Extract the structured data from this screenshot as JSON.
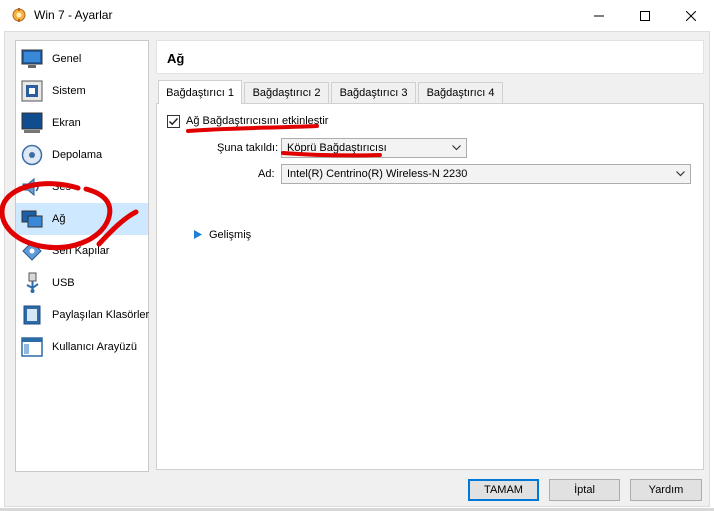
{
  "window": {
    "title": "Win 7 - Ayarlar",
    "minimize_icon": "minimize-icon",
    "maximize_icon": "maximize-icon",
    "close_icon": "close-icon"
  },
  "sidebar": {
    "items": [
      {
        "label": "Genel",
        "icon": "monitor-icon",
        "selected": false
      },
      {
        "label": "Sistem",
        "icon": "chip-icon",
        "selected": false
      },
      {
        "label": "Ekran",
        "icon": "display-icon",
        "selected": false
      },
      {
        "label": "Depolama",
        "icon": "disk-icon",
        "selected": false
      },
      {
        "label": "Ses",
        "icon": "speaker-icon",
        "selected": false
      },
      {
        "label": "Ağ",
        "icon": "network-icon",
        "selected": true
      },
      {
        "label": "Seri Kapılar",
        "icon": "serial-port-icon",
        "selected": false
      },
      {
        "label": "USB",
        "icon": "usb-icon",
        "selected": false
      },
      {
        "label": "Paylaşılan Klasörler",
        "icon": "folder-icon",
        "selected": false
      },
      {
        "label": "Kullanıcı Arayüzü",
        "icon": "ui-window-icon",
        "selected": false
      }
    ]
  },
  "page": {
    "title": "Ağ",
    "tabs": [
      {
        "label": "Bağdaştırıcı 1",
        "active": true
      },
      {
        "label": "Bağdaştırıcı 2",
        "active": false
      },
      {
        "label": "Bağdaştırıcı 3",
        "active": false
      },
      {
        "label": "Bağdaştırıcı 4",
        "active": false
      }
    ],
    "enable_adapter": {
      "label": "Ağ Bağdaştırıcısını etkinleştir",
      "checked": true
    },
    "attached_to": {
      "label": "Şuna takıldı:",
      "value": "Köprü Bağdaştırıcısı"
    },
    "name": {
      "label": "Ad:",
      "value": "Intel(R) Centrino(R) Wireless-N 2230"
    },
    "advanced": {
      "label": "Gelişmiş"
    }
  },
  "buttons": {
    "ok": "TAMAM",
    "cancel": "İptal",
    "help": "Yardım"
  },
  "colors": {
    "selection": "#cde8ff",
    "accent": "#0078d7",
    "annotation": "#e00000"
  }
}
